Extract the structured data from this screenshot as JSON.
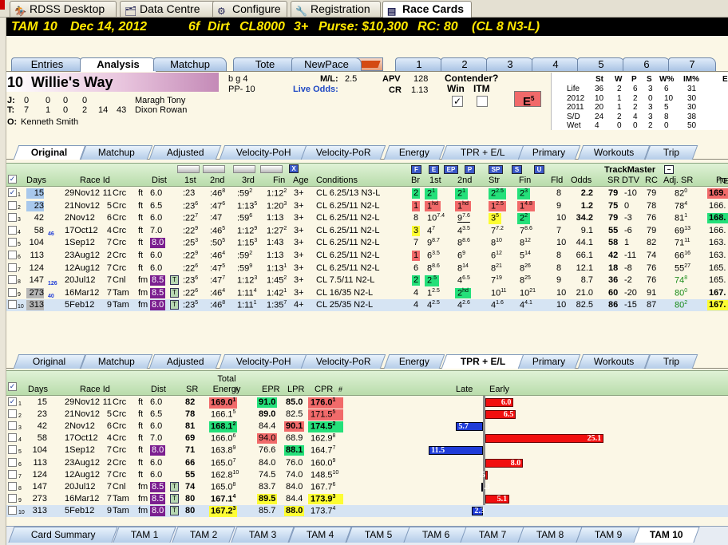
{
  "top_tabs": [
    {
      "label": "RDSS Desktop",
      "icon": "racing-horse-icon"
    },
    {
      "label": "Data Centre",
      "icon": "folder-icon"
    },
    {
      "label": "Configure",
      "icon": "gear-icon"
    },
    {
      "label": "Registration",
      "icon": "key-icon"
    },
    {
      "label": "Race Cards",
      "icon": "document-icon"
    }
  ],
  "race_header": {
    "track": "TAM",
    "race": "10",
    "date": "Dec 14, 2012",
    "distance": "6f",
    "surface": "Dirt",
    "class": "CL8000",
    "age": "3+",
    "purse": "Purse: $10,300",
    "rc": "RC: 80",
    "rc_detail": "(CL 8 N3-L)"
  },
  "view_tabs": [
    "Entries",
    "Analysis",
    "Matchup",
    "Tote",
    "NewPace"
  ],
  "horse_num_tabs": [
    "1",
    "2",
    "3",
    "4",
    "5",
    "6",
    "7"
  ],
  "horse": {
    "post": "10",
    "name": "Willie's Way",
    "sex_age": "b g 4",
    "pp": "PP- 10",
    "ml_label": "M/L:",
    "ml_value": "2.5",
    "live_odds_label": "Live Odds:",
    "apv_label": "APV",
    "apv_value": "128",
    "cr_label": "CR",
    "cr_value": "1.13",
    "contender_label": "Contender?",
    "win_label": "Win",
    "itm_label": "ITM",
    "e_rating": "E",
    "e_sup": "5",
    "j_label": "J:",
    "j_stats": [
      "0",
      "0",
      "0",
      "0"
    ],
    "jockey": "Maragh Tony",
    "t_label": "T:",
    "t_stats": [
      "7",
      "1",
      "0",
      "2",
      "14",
      "43"
    ],
    "trainer": "Dixon Rowan",
    "o_label": "O:",
    "owner": "Kenneth Smith"
  },
  "record": {
    "headers": [
      "St",
      "W",
      "P",
      "S",
      "W%",
      "IM%",
      "E"
    ],
    "rows": [
      {
        "label": "Life",
        "values": [
          "36",
          "2",
          "6",
          "3",
          "6",
          "31"
        ]
      },
      {
        "label": "2012",
        "values": [
          "10",
          "1",
          "2",
          "0",
          "10",
          "30"
        ]
      },
      {
        "label": "2011",
        "values": [
          "20",
          "1",
          "2",
          "3",
          "5",
          "30"
        ]
      },
      {
        "label": "S/D",
        "values": [
          "24",
          "2",
          "4",
          "3",
          "8",
          "38"
        ]
      },
      {
        "label": "Wet",
        "values": [
          "4",
          "0",
          "0",
          "2",
          "0",
          "50"
        ]
      }
    ]
  },
  "sub_tabs": [
    "Original",
    "Matchup",
    "Adjusted",
    "Velocity-PoH",
    "Velocity-PoR",
    "Energy",
    "TPR + E/L",
    "Primary",
    "Workouts",
    "Trip"
  ],
  "pp_headers": {
    "days": "Days",
    "race_id": "Race Id",
    "dist": "Dist",
    "first": "1st",
    "second": "2nd",
    "third": "3rd",
    "fin": "Fin",
    "age": "Age",
    "conditions": "Conditions",
    "br": "Br",
    "c1st": "1st",
    "c2nd": "2nd",
    "str": "Str",
    "cfin": "Fin",
    "fld": "Fld",
    "odds": "Odds",
    "trackmaster": "TrackMaster",
    "sr": "SR",
    "dtv": "DTV",
    "rc": "RC",
    "adj_sr": "Adj. SR",
    "po": "Po",
    "te": "TE"
  },
  "filter_buttons": [
    "F",
    "E",
    "EP",
    "P",
    "SP",
    "S",
    "U"
  ],
  "pp_rows": [
    {
      "n": "1",
      "days": "15",
      "date": "29Nov12",
      "rn": "11",
      "trk": "Crc",
      "surf": "ft",
      "dist": "6.0",
      "f1": ":23",
      "f2": ":46",
      "f2s": "8",
      "f3": ":59",
      "f3s": "2",
      "fin": "1:12",
      "fins": "2",
      "age": "3+",
      "cond": "CL 6.25/13 N3-L",
      "br": "2",
      "c1": "2",
      "c1s": "1",
      "c2": "2",
      "c2s": "1",
      "str": "2",
      "strs": "2.5",
      "cf": "2",
      "cfs": "3",
      "fld": "8",
      "odds": "2.2",
      "sr": "79",
      "dtv": "-10",
      "rc": "79",
      "adj": "82",
      "adjs": "0",
      "po": "169."
    },
    {
      "n": "2",
      "days": "23",
      "date": "21Nov12",
      "rn": "5",
      "trk": "Crc",
      "surf": "ft",
      "dist": "6.5",
      "f1": ":23",
      "f1s": "6",
      "f2": ":47",
      "f2s": "6",
      "f3": "1:13",
      "f3s": "5",
      "fin": "1:20",
      "fins": "3",
      "age": "3+",
      "cond": "CL 6.25/11 N2-L",
      "br": "1",
      "c1": "1",
      "c1s": "hd",
      "c2": "1",
      "c2s": "hd",
      "str": "1",
      "strs": "2.5",
      "cf": "1",
      "cfs": "4.8",
      "fld": "9",
      "odds": "1.2",
      "sr": "75",
      "dtv": "0",
      "rc": "78",
      "adj": "78",
      "adjs": "4",
      "po": "166."
    },
    {
      "n": "3",
      "days": "42",
      "date": "2Nov12",
      "rn": "6",
      "trk": "Crc",
      "surf": "ft",
      "dist": "6.0",
      "f1": ":22",
      "f1s": "7",
      "f2": ":47",
      "f3": ":59",
      "f3s": "6",
      "fin": "1:13",
      "age": "3+",
      "cond": "CL 6.25/11 N2-L",
      "br": "8",
      "c1": "10",
      "c1s": "7.4",
      "c2": "9",
      "c2s": "7.6",
      "str": "3",
      "strs": "5",
      "cf": "2",
      "cfs": "2",
      "fld": "10",
      "odds": "34.2",
      "sr": "79",
      "dtv": "-3",
      "rc": "76",
      "adj": "81",
      "adjs": "1",
      "po": "168."
    },
    {
      "n": "4",
      "days": "58",
      "dsup": "46",
      "date": "17Oct12",
      "rn": "4",
      "trk": "Crc",
      "surf": "ft",
      "dist": "7.0",
      "f1": ":22",
      "f1s": "9",
      "f2": ":46",
      "f2s": "5",
      "f3": "1:12",
      "f3s": "9",
      "fin": "1:27",
      "fins": "2",
      "age": "3+",
      "cond": "CL 6.25/11 N2-L",
      "br": "3",
      "c1": "4",
      "c1s": "7",
      "c2": "4",
      "c2s": "3.5",
      "str": "7",
      "strs": "7.2",
      "cf": "7",
      "cfs": "8.6",
      "fld": "7",
      "odds": "9.1",
      "sr": "55",
      "dtv": "-6",
      "rc": "79",
      "adj": "69",
      "adjs": "13",
      "po": "166."
    },
    {
      "n": "5",
      "days": "104",
      "date": "1Sep12",
      "rn": "7",
      "trk": "Crc",
      "surf": "ft",
      "dist": "8.0",
      "f1": ":25",
      "f1s": "3",
      "f2": ":50",
      "f2s": "5",
      "f3": "1:15",
      "f3s": "3",
      "fin": "1:43",
      "age": "3+",
      "cond": "CL 6.25/11 N2-L",
      "br": "7",
      "c1": "9",
      "c1s": "8.7",
      "c2": "8",
      "c2s": "8.6",
      "str": "8",
      "strs": "10",
      "cf": "8",
      "cfs": "12",
      "fld": "10",
      "odds": "44.1",
      "sr": "58",
      "dtv": "1",
      "rc": "82",
      "adj": "71",
      "adjs": "11",
      "po": "163."
    },
    {
      "n": "6",
      "days": "113",
      "date": "23Aug12",
      "rn": "2",
      "trk": "Crc",
      "surf": "ft",
      "dist": "6.0",
      "f1": ":22",
      "f1s": "9",
      "f2": ":46",
      "f2s": "4",
      "f3": ":59",
      "f3s": "2",
      "fin": "1:13",
      "age": "3+",
      "cond": "CL 6.25/11 N2-L",
      "br": "1",
      "c1": "6",
      "c1s": "3.5",
      "c2": "6",
      "c2s": "9",
      "str": "6",
      "strs": "12",
      "cf": "5",
      "cfs": "14",
      "fld": "8",
      "odds": "66.1",
      "sr": "42",
      "dtv": "-11",
      "rc": "74",
      "adj": "66",
      "adjs": "16",
      "po": "163."
    },
    {
      "n": "7",
      "days": "124",
      "date": "12Aug12",
      "rn": "7",
      "trk": "Crc",
      "surf": "ft",
      "dist": "6.0",
      "f1": ":22",
      "f1s": "6",
      "f2": ":47",
      "f2s": "5",
      "f3": ":59",
      "f3s": "9",
      "fin": "1:13",
      "fins": "1",
      "age": "3+",
      "cond": "CL 6.25/11 N2-L",
      "br": "6",
      "c1": "8",
      "c1s": "8.6",
      "c2": "8",
      "c2s": "14",
      "str": "8",
      "strs": "21",
      "cf": "8",
      "cfs": "26",
      "fld": "8",
      "odds": "12.1",
      "sr": "18",
      "dtv": "-8",
      "rc": "76",
      "adj": "55",
      "adjs": "27",
      "po": "165."
    },
    {
      "n": "8",
      "days": "147",
      "dsup": "126",
      "date": "20Jul12",
      "rn": "7",
      "trk": "Cnl",
      "surf": "fm",
      "dist": "8.5",
      "tt": "T",
      "f1": ":23",
      "f1s": "6",
      "f2": ":47",
      "f2s": "7",
      "f3": "1:12",
      "f3s": "3",
      "fin": "1:45",
      "fins": "2",
      "age": "3+",
      "cond": "CL 7.5/11 N2-L",
      "br": "2",
      "c1": "2",
      "c1s": ".5",
      "c2": "4",
      "c2s": "6.5",
      "str": "7",
      "strs": "19",
      "cf": "8",
      "cfs": "25",
      "fld": "9",
      "odds": "8.7",
      "sr": "36",
      "dtv": "-2",
      "rc": "76",
      "adj": "74",
      "adjs": "8",
      "po": "165."
    },
    {
      "n": "9",
      "days": "273",
      "dsup": "40",
      "date": "16Mar12",
      "rn": "7",
      "trk": "Tam",
      "surf": "fm",
      "dist": "8.5",
      "tt": "T",
      "f1": ":22",
      "f1s": "6",
      "f2": ":46",
      "f2s": "4",
      "f3": "1:11",
      "f3s": "4",
      "fin": "1:42",
      "fins": "1",
      "age": "3+",
      "cond": "CL 16/35 N2-L",
      "br": "4",
      "c1": "1",
      "c1s": "2.5",
      "c2": "2",
      "c2s": "hd",
      "str": "10",
      "strs": "11",
      "cf": "10",
      "cfs": "21",
      "fld": "10",
      "odds": "21.0",
      "sr": "60",
      "dtv": "-20",
      "rc": "91",
      "adj": "80",
      "adjs": "0",
      "po": "167."
    },
    {
      "n": "10",
      "days": "313",
      "date": "5Feb12",
      "rn": "9",
      "trk": "Tam",
      "surf": "fm",
      "dist": "8.0",
      "tt": "T",
      "f1": ":23",
      "f1s": "5",
      "f2": ":46",
      "f2s": "8",
      "f3": "1:11",
      "f3s": "1",
      "fin": "1:35",
      "fins": "7",
      "age": "4+",
      "cond": "CL 25/35 N2-L",
      "br": "4",
      "c1": "4",
      "c1s": "2.5",
      "c2": "4",
      "c2s": "2.6",
      "str": "4",
      "strs": "1.6",
      "cf": "4",
      "cfs": "4.1",
      "fld": "10",
      "odds": "82.5",
      "sr": "86",
      "dtv": "-15",
      "rc": "87",
      "adj": "80",
      "adjs": "2",
      "po": "167."
    }
  ],
  "bottom_tabs": [
    "Original",
    "Matchup",
    "Adjusted",
    "Velocity-PoH",
    "Velocity-PoR",
    "Energy",
    "TPR + E/L",
    "Primary",
    "Workouts",
    "Trip"
  ],
  "tpr_headers": {
    "days": "Days",
    "race_id": "Race Id",
    "dist": "Dist",
    "sr": "SR",
    "total_energy": "Total Energy",
    "hash": "#",
    "epr": "EPR",
    "lpr": "LPR",
    "cpr": "CPR",
    "late": "Late",
    "early": "Early"
  },
  "tpr_rows": [
    {
      "n": "1",
      "days": "15",
      "date": "29Nov12",
      "rn": "11",
      "trk": "Crc",
      "surf": "ft",
      "dist": "6.0",
      "sr": "82",
      "te": "169.0",
      "tes": "1",
      "epr": "91.0",
      "lpr": "85.0",
      "cpr": "176.0",
      "cprs": "1",
      "bar": 6.0,
      "bar_label": "6.0"
    },
    {
      "n": "2",
      "days": "23",
      "date": "21Nov12",
      "rn": "5",
      "trk": "Crc",
      "surf": "ft",
      "dist": "6.5",
      "sr": "78",
      "te": "166.1",
      "tes": "5",
      "epr": "89.0",
      "lpr": "82.5",
      "cpr": "171.5",
      "cprs": "5",
      "bar": 6.5,
      "bar_label": "6.5"
    },
    {
      "n": "3",
      "days": "42",
      "date": "2Nov12",
      "rn": "6",
      "trk": "Crc",
      "surf": "ft",
      "dist": "6.0",
      "sr": "81",
      "te": "168.1",
      "tes": "2",
      "epr": "84.4",
      "lpr": "90.1",
      "cpr": "174.5",
      "cprs": "2",
      "bar": -5.7,
      "bar_label": "5.7"
    },
    {
      "n": "4",
      "days": "58",
      "date": "17Oct12",
      "rn": "4",
      "trk": "Crc",
      "surf": "ft",
      "dist": "7.0",
      "sr": "69",
      "te": "166.0",
      "tes": "6",
      "epr": "94.0",
      "lpr": "68.9",
      "cpr": "162.9",
      "cprs": "8",
      "bar": 25.1,
      "bar_label": "25.1"
    },
    {
      "n": "5",
      "days": "104",
      "date": "1Sep12",
      "rn": "7",
      "trk": "Crc",
      "surf": "ft",
      "dist": "8.0",
      "sr": "71",
      "te": "163.8",
      "tes": "9",
      "epr": "76.6",
      "lpr": "88.1",
      "cpr": "164.7",
      "cprs": "7",
      "bar": -11.5,
      "bar_label": "11.5"
    },
    {
      "n": "6",
      "days": "113",
      "date": "23Aug12",
      "rn": "2",
      "trk": "Crc",
      "surf": "ft",
      "dist": "6.0",
      "sr": "66",
      "te": "165.0",
      "tes": "7",
      "epr": "84.0",
      "lpr": "76.0",
      "cpr": "160.0",
      "cprs": "9",
      "bar": 8.0,
      "bar_label": "8.0"
    },
    {
      "n": "7",
      "days": "124",
      "date": "12Aug12",
      "rn": "7",
      "trk": "Crc",
      "surf": "ft",
      "dist": "6.0",
      "sr": "55",
      "te": "162.8",
      "tes": "10",
      "epr": "74.5",
      "lpr": "74.0",
      "cpr": "148.5",
      "cprs": "10",
      "bar": 0.5,
      "bar_label": ".5"
    },
    {
      "n": "8",
      "days": "147",
      "date": "20Jul12",
      "rn": "7",
      "trk": "Cnl",
      "surf": "fm",
      "dist": "8.5",
      "tt": "T",
      "sr": "74",
      "te": "165.0",
      "tes": "8",
      "epr": "83.7",
      "lpr": "84.0",
      "cpr": "167.7",
      "cprs": "6",
      "bar": -0.3,
      "bar_label": ".3"
    },
    {
      "n": "9",
      "days": "273",
      "date": "16Mar12",
      "rn": "7",
      "trk": "Tam",
      "surf": "fm",
      "dist": "8.5",
      "tt": "T",
      "sr": "80",
      "te": "167.1",
      "tes": "4",
      "epr": "89.5",
      "lpr": "84.4",
      "cpr": "173.9",
      "cprs": "3",
      "bar": 5.1,
      "bar_label": "5.1"
    },
    {
      "n": "10",
      "days": "313",
      "date": "5Feb12",
      "rn": "9",
      "trk": "Tam",
      "surf": "fm",
      "dist": "8.0",
      "tt": "T",
      "sr": "80",
      "te": "167.2",
      "tes": "3",
      "epr": "85.7",
      "lpr": "88.0",
      "cpr": "173.7",
      "cprs": "4",
      "bar": -2.3,
      "bar_label": "2.3"
    }
  ],
  "race_tabs": [
    "Card Summary",
    "TAM 1",
    "TAM 2",
    "TAM 3",
    "TAM 4",
    "TAM 5",
    "TAM 6",
    "TAM 7",
    "TAM 8",
    "TAM 9",
    "TAM 10"
  ]
}
